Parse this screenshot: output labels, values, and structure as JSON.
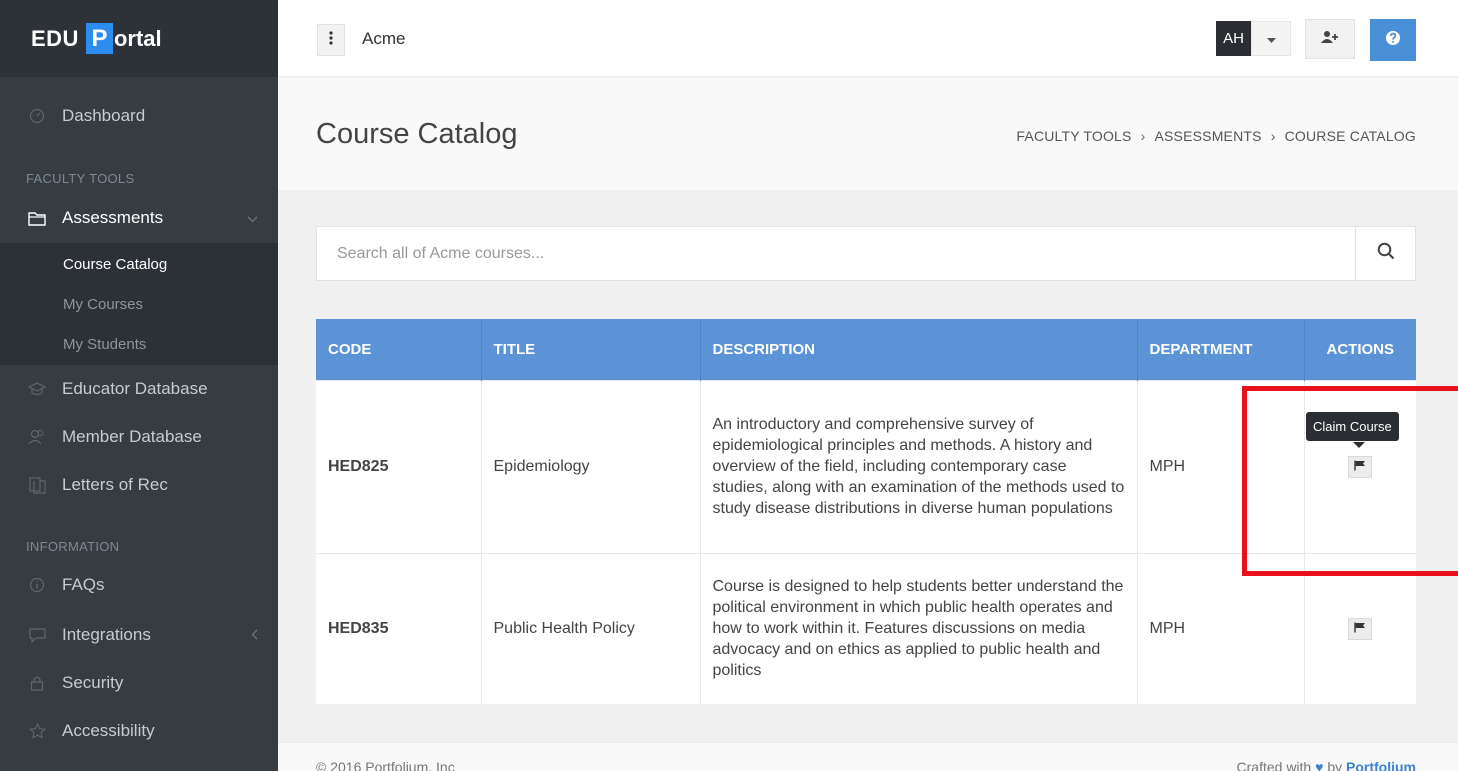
{
  "brand": {
    "edu": "EDU",
    "p": "P",
    "ortal": "ortal"
  },
  "sidebar": {
    "dashboard": "Dashboard",
    "heading_faculty": "FACULTY TOOLS",
    "assessments": "Assessments",
    "sub": [
      "Course Catalog",
      "My Courses",
      "My Students"
    ],
    "educator_db": "Educator Database",
    "member_db": "Member Database",
    "letters": "Letters of Rec",
    "heading_info": "INFORMATION",
    "faqs": "FAQs",
    "integrations": "Integrations",
    "security": "Security",
    "accessibility": "Accessibility"
  },
  "topbar": {
    "title": "Acme",
    "avatar": "AH"
  },
  "header": {
    "title": "Course Catalog",
    "breadcrumb": [
      "FACULTY TOOLS",
      "ASSESSMENTS",
      "COURSE CATALOG"
    ]
  },
  "search": {
    "placeholder": "Search all of Acme courses..."
  },
  "table": {
    "columns": [
      "CODE",
      "TITLE",
      "DESCRIPTION",
      "DEPARTMENT",
      "ACTIONS"
    ],
    "rows": [
      {
        "code": "HED825",
        "title": "Epidemiology",
        "description": "An introductory and comprehensive survey of epidemiological principles and methods. A history and overview of the field, including contemporary case studies, along with an examination of the methods used to study disease distributions in diverse human populations",
        "department": "MPH"
      },
      {
        "code": "HED835",
        "title": "Public Health Policy",
        "description": "Course is designed to help students better understand the political environment in which public health operates and how to work within it. Features discussions on media advocacy and on ethics as applied to public health and politics",
        "department": "MPH"
      }
    ],
    "tooltip": "Claim Course"
  },
  "footer": {
    "left": "© 2016 Portfolium, Inc",
    "right_prefix": "Crafted with",
    "right_by": "by",
    "right_link": "Portfolium"
  },
  "colors": {
    "accent": "#5b93d6",
    "sidebar": "#353c42",
    "highlight": "#e8111a"
  }
}
